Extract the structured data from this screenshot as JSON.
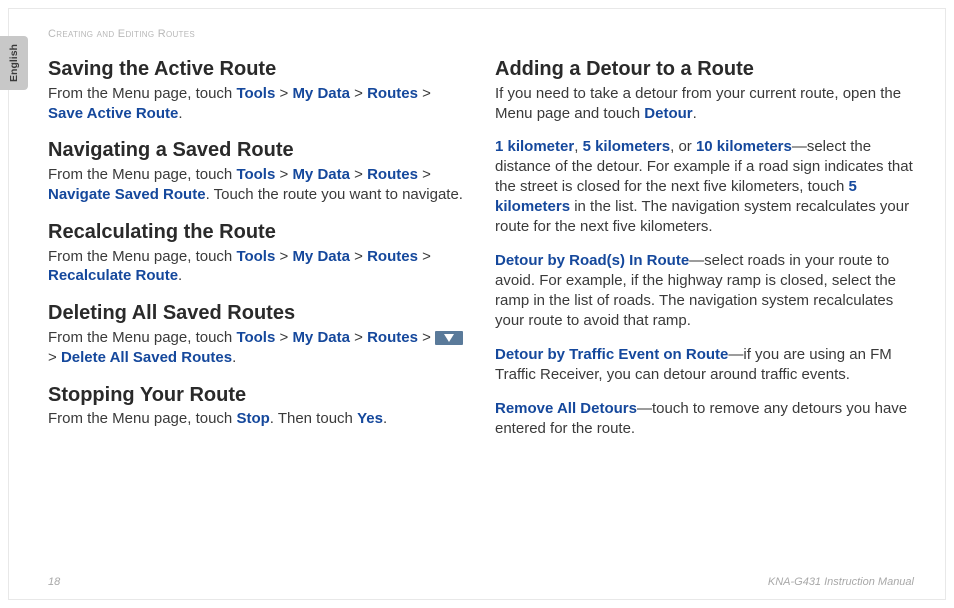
{
  "header": {
    "breadcrumb": "Creating and Editing Routes"
  },
  "lang_tab": "English",
  "left": {
    "s1": {
      "title": "Saving the Active Route",
      "lead": "From the Menu page, touch ",
      "a1": "Tools",
      "a2": "My Data",
      "a3": "Routes",
      "a4": "Save Active Route",
      "tail": "."
    },
    "s2": {
      "title": "Navigating a Saved Route",
      "lead": "From the Menu page, touch ",
      "a1": "Tools",
      "a2": "My Data",
      "a3": "Routes",
      "a4": "Navigate Saved Route",
      "tail": ". Touch the route you want to navigate."
    },
    "s3": {
      "title": "Recalculating the Route",
      "lead": "From the Menu page, touch ",
      "a1": "Tools",
      "a2": "My Data",
      "a3": "Routes",
      "a4": "Recalculate Route",
      "tail": "."
    },
    "s4": {
      "title": "Deleting All Saved Routes",
      "lead": "From the Menu page, touch ",
      "a1": "Tools",
      "a2": "My Data",
      "a3": "Routes",
      "a4": "Delete All Saved Routes",
      "tail": "."
    },
    "s5": {
      "title": "Stopping Your Route",
      "lead": "From the Menu page, touch ",
      "a1": "Stop",
      "mid": ". Then touch ",
      "a2": "Yes",
      "tail": "."
    }
  },
  "right": {
    "title": "Adding a Detour to a Route",
    "p1a": "If you need to take a detour from your current route, open the Menu page and touch ",
    "p1b": "Detour",
    "p1c": ".",
    "p2": {
      "k1": "1 kilometer",
      "c1": ", ",
      "k2": "5 kilometers",
      "c2": ", or ",
      "k3": "10 kilometers",
      "t1": "—select the distance of the detour. For example if a road sign indicates that the street is closed for the next five kilometers, touch ",
      "k4": "5 kilometers",
      "t2": " in the list. The navigation system recalculates your route for the next five kilometers."
    },
    "p3": {
      "k1": "Detour by Road(s) In Route",
      "t1": "—select roads in your route to avoid. For example, if the highway ramp is closed, select the ramp in the list of roads. The navigation system recalculates your route to avoid that ramp."
    },
    "p4": {
      "k1": "Detour by Traffic Event on Route",
      "t1": "—if you are using an FM Traffic Receiver, you can detour around traffic events."
    },
    "p5": {
      "k1": "Remove All Detours",
      "t1": "—touch to remove any detours you have entered for the route."
    }
  },
  "footer": {
    "page": "18",
    "manual": "KNA-G431 Instruction Manual"
  },
  "sep": " > "
}
